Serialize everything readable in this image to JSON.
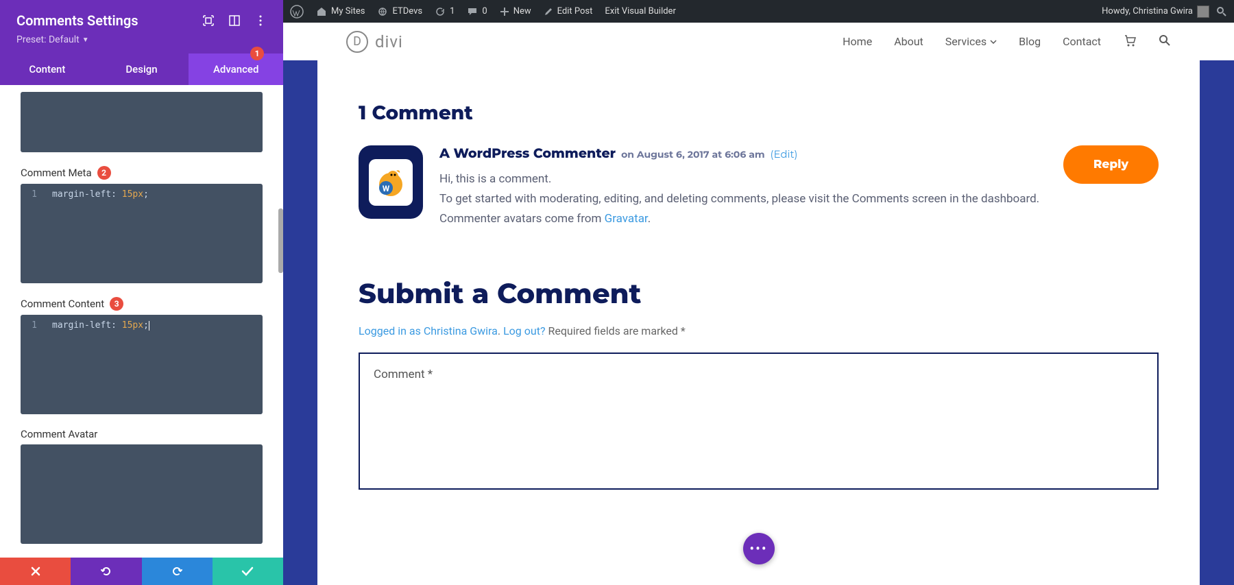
{
  "sidebar": {
    "title": "Comments Settings",
    "preset_label": "Preset: Default",
    "tabs": {
      "content": "Content",
      "design": "Design",
      "advanced": "Advanced",
      "advanced_badge": "1"
    },
    "sections": {
      "comment_meta": {
        "label": "Comment Meta",
        "badge": "2",
        "code_line": "1",
        "code_prop": "margin-left",
        "code_val": "15px"
      },
      "comment_content": {
        "label": "Comment Content",
        "badge": "3",
        "code_line": "1",
        "code_prop": "margin-left",
        "code_val": "15px"
      },
      "comment_avatar": {
        "label": "Comment Avatar"
      }
    }
  },
  "adminbar": {
    "my_sites": "My Sites",
    "etdevs": "ETDevs",
    "updates": "1",
    "comments": "0",
    "new": "New",
    "edit_post": "Edit Post",
    "exit_vb": "Exit Visual Builder",
    "howdy": "Howdy, Christina Gwira"
  },
  "site": {
    "logo_text": "divi",
    "nav": {
      "home": "Home",
      "about": "About",
      "services": "Services",
      "blog": "Blog",
      "contact": "Contact"
    }
  },
  "comments_area": {
    "title": "1 Comment",
    "comment": {
      "author": "A WordPress Commenter",
      "date": "on August 6, 2017 at 6:06 am",
      "edit": "(Edit)",
      "line1": "Hi, this is a comment.",
      "line2": "To get started with moderating, editing, and deleting comments, please visit the Comments screen in the dashboard.",
      "line3_prefix": "Commenter avatars come from ",
      "line3_link": "Gravatar",
      "reply": "Reply"
    },
    "submit": {
      "title": "Submit a Comment",
      "logged_in": "Logged in as Christina Gwira",
      "logout": "Log out?",
      "required": " Required fields are marked *",
      "placeholder": "Comment *"
    }
  }
}
